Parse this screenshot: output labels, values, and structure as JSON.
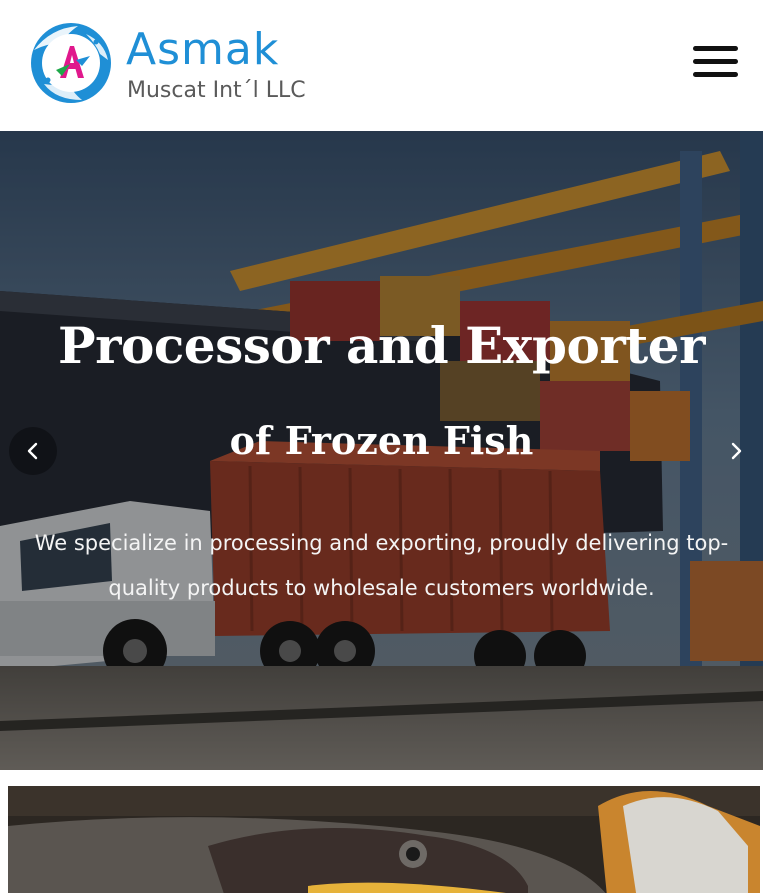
{
  "header": {
    "brand_name": "Asmak",
    "brand_sub": "Muscat Int´l LLC",
    "logo_icon": "fish-logo-icon",
    "menu_icon": "hamburger-menu-icon",
    "brand_color": "#1f8fd6"
  },
  "hero": {
    "title": "Processor and Exporter",
    "subtitle": "of Frozen Fish",
    "description": "We specialize in processing and exporting, proudly delivering top-quality products to wholesale customers worldwide.",
    "prev_icon": "chevron-left-icon",
    "next_icon": "chevron-right-icon",
    "background_image": "container-port-truck-image"
  },
  "section2": {
    "image": "frozen-fish-image"
  }
}
